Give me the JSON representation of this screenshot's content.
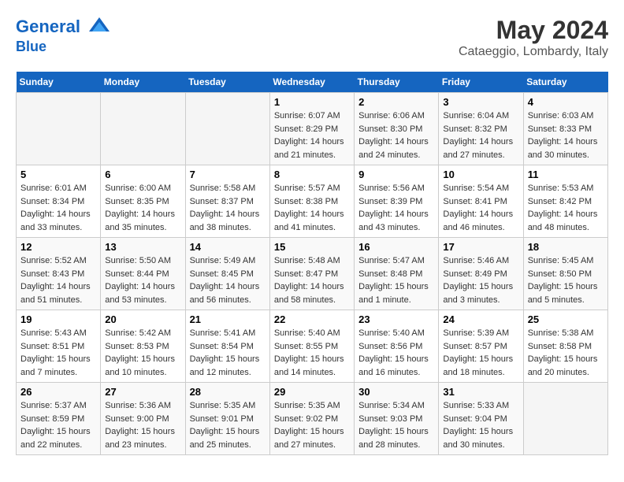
{
  "header": {
    "logo_line1": "General",
    "logo_line2": "Blue",
    "main_title": "May 2024",
    "sub_title": "Cataeggio, Lombardy, Italy"
  },
  "weekdays": [
    "Sunday",
    "Monday",
    "Tuesday",
    "Wednesday",
    "Thursday",
    "Friday",
    "Saturday"
  ],
  "weeks": [
    [
      {
        "day": "",
        "info": ""
      },
      {
        "day": "",
        "info": ""
      },
      {
        "day": "",
        "info": ""
      },
      {
        "day": "1",
        "info": "Sunrise: 6:07 AM\nSunset: 8:29 PM\nDaylight: 14 hours and 21 minutes."
      },
      {
        "day": "2",
        "info": "Sunrise: 6:06 AM\nSunset: 8:30 PM\nDaylight: 14 hours and 24 minutes."
      },
      {
        "day": "3",
        "info": "Sunrise: 6:04 AM\nSunset: 8:32 PM\nDaylight: 14 hours and 27 minutes."
      },
      {
        "day": "4",
        "info": "Sunrise: 6:03 AM\nSunset: 8:33 PM\nDaylight: 14 hours and 30 minutes."
      }
    ],
    [
      {
        "day": "5",
        "info": "Sunrise: 6:01 AM\nSunset: 8:34 PM\nDaylight: 14 hours and 33 minutes."
      },
      {
        "day": "6",
        "info": "Sunrise: 6:00 AM\nSunset: 8:35 PM\nDaylight: 14 hours and 35 minutes."
      },
      {
        "day": "7",
        "info": "Sunrise: 5:58 AM\nSunset: 8:37 PM\nDaylight: 14 hours and 38 minutes."
      },
      {
        "day": "8",
        "info": "Sunrise: 5:57 AM\nSunset: 8:38 PM\nDaylight: 14 hours and 41 minutes."
      },
      {
        "day": "9",
        "info": "Sunrise: 5:56 AM\nSunset: 8:39 PM\nDaylight: 14 hours and 43 minutes."
      },
      {
        "day": "10",
        "info": "Sunrise: 5:54 AM\nSunset: 8:41 PM\nDaylight: 14 hours and 46 minutes."
      },
      {
        "day": "11",
        "info": "Sunrise: 5:53 AM\nSunset: 8:42 PM\nDaylight: 14 hours and 48 minutes."
      }
    ],
    [
      {
        "day": "12",
        "info": "Sunrise: 5:52 AM\nSunset: 8:43 PM\nDaylight: 14 hours and 51 minutes."
      },
      {
        "day": "13",
        "info": "Sunrise: 5:50 AM\nSunset: 8:44 PM\nDaylight: 14 hours and 53 minutes."
      },
      {
        "day": "14",
        "info": "Sunrise: 5:49 AM\nSunset: 8:45 PM\nDaylight: 14 hours and 56 minutes."
      },
      {
        "day": "15",
        "info": "Sunrise: 5:48 AM\nSunset: 8:47 PM\nDaylight: 14 hours and 58 minutes."
      },
      {
        "day": "16",
        "info": "Sunrise: 5:47 AM\nSunset: 8:48 PM\nDaylight: 15 hours and 1 minute."
      },
      {
        "day": "17",
        "info": "Sunrise: 5:46 AM\nSunset: 8:49 PM\nDaylight: 15 hours and 3 minutes."
      },
      {
        "day": "18",
        "info": "Sunrise: 5:45 AM\nSunset: 8:50 PM\nDaylight: 15 hours and 5 minutes."
      }
    ],
    [
      {
        "day": "19",
        "info": "Sunrise: 5:43 AM\nSunset: 8:51 PM\nDaylight: 15 hours and 7 minutes."
      },
      {
        "day": "20",
        "info": "Sunrise: 5:42 AM\nSunset: 8:53 PM\nDaylight: 15 hours and 10 minutes."
      },
      {
        "day": "21",
        "info": "Sunrise: 5:41 AM\nSunset: 8:54 PM\nDaylight: 15 hours and 12 minutes."
      },
      {
        "day": "22",
        "info": "Sunrise: 5:40 AM\nSunset: 8:55 PM\nDaylight: 15 hours and 14 minutes."
      },
      {
        "day": "23",
        "info": "Sunrise: 5:40 AM\nSunset: 8:56 PM\nDaylight: 15 hours and 16 minutes."
      },
      {
        "day": "24",
        "info": "Sunrise: 5:39 AM\nSunset: 8:57 PM\nDaylight: 15 hours and 18 minutes."
      },
      {
        "day": "25",
        "info": "Sunrise: 5:38 AM\nSunset: 8:58 PM\nDaylight: 15 hours and 20 minutes."
      }
    ],
    [
      {
        "day": "26",
        "info": "Sunrise: 5:37 AM\nSunset: 8:59 PM\nDaylight: 15 hours and 22 minutes."
      },
      {
        "day": "27",
        "info": "Sunrise: 5:36 AM\nSunset: 9:00 PM\nDaylight: 15 hours and 23 minutes."
      },
      {
        "day": "28",
        "info": "Sunrise: 5:35 AM\nSunset: 9:01 PM\nDaylight: 15 hours and 25 minutes."
      },
      {
        "day": "29",
        "info": "Sunrise: 5:35 AM\nSunset: 9:02 PM\nDaylight: 15 hours and 27 minutes."
      },
      {
        "day": "30",
        "info": "Sunrise: 5:34 AM\nSunset: 9:03 PM\nDaylight: 15 hours and 28 minutes."
      },
      {
        "day": "31",
        "info": "Sunrise: 5:33 AM\nSunset: 9:04 PM\nDaylight: 15 hours and 30 minutes."
      },
      {
        "day": "",
        "info": ""
      }
    ]
  ]
}
